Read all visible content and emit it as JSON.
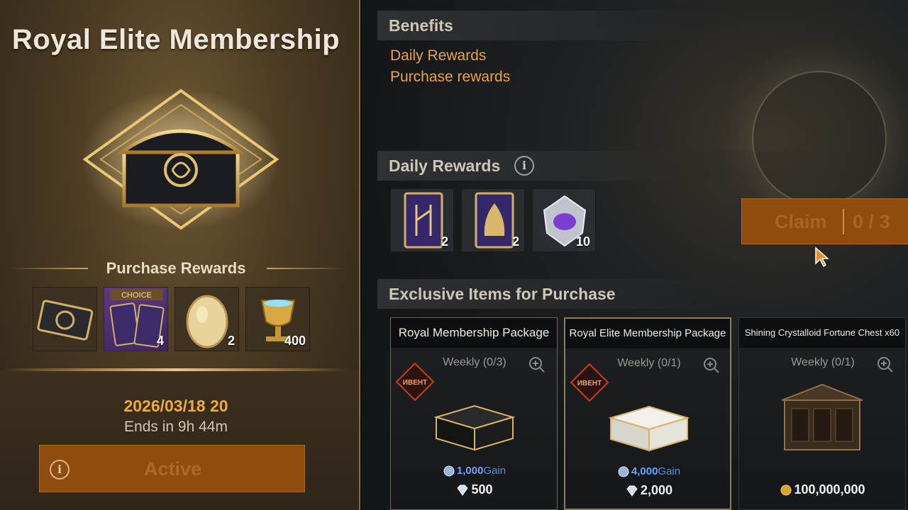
{
  "left": {
    "title": "Royal Elite Membership",
    "purchase_rewards_heading": "Purchase Rewards",
    "purchase_items": [
      {
        "icon": "dragon-card-icon",
        "qty": ""
      },
      {
        "icon": "choice-cards-icon",
        "qty": "4",
        "tag": "CHOICE"
      },
      {
        "icon": "golden-egg-icon",
        "qty": "2"
      },
      {
        "icon": "trophy-icon",
        "qty": "400"
      }
    ],
    "date": "2026/03/18 20",
    "ends": "Ends in 9h 44m",
    "active_label": "Active"
  },
  "right": {
    "benefits_heading": "Benefits",
    "benefits": [
      "Daily Rewards",
      "Purchase rewards"
    ],
    "daily_heading": "Daily Rewards",
    "daily_items": [
      {
        "icon": "rune-card-icon",
        "qty": "2"
      },
      {
        "icon": "hood-card-icon",
        "qty": "2"
      },
      {
        "icon": "crystal-icon",
        "qty": "10"
      }
    ],
    "claim_label": "Claim",
    "claim_count": "0 / 3",
    "exclusive_heading": "Exclusive Items for Purchase",
    "cards": [
      {
        "title": "Royal Membership Package",
        "weekly": "Weekly (0/3)",
        "badge": "ИВЕНТ",
        "gain_value": "1,000",
        "gain_label": "Gain",
        "price": "500",
        "currency": "diamond"
      },
      {
        "title": "Royal Elite Membership Package",
        "weekly": "Weekly (0/1)",
        "badge": "ИВЕНТ",
        "gain_value": "4,000",
        "gain_label": "Gain",
        "price": "2,000",
        "currency": "diamond"
      },
      {
        "title": "Shining Crystalloid Fortune Chest x60",
        "weekly": "Weekly (0/1)",
        "badge": "",
        "gain_value": "",
        "gain_label": "",
        "price": "100,000,000",
        "currency": "gold"
      }
    ]
  },
  "colors": {
    "accent_orange": "#eaa24a",
    "date_orange": "#f0a93c",
    "button_bg": "#8e4d0e",
    "gain_blue": "#6fa3ff"
  }
}
